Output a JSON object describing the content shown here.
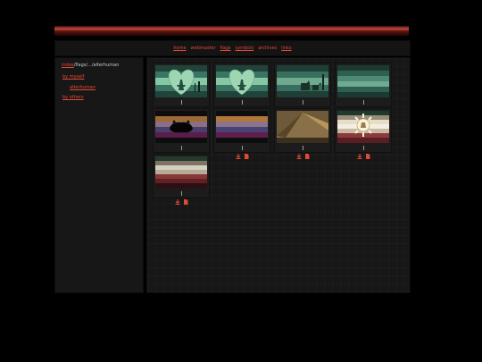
{
  "nav": {
    "items": [
      {
        "label": "home",
        "underline": true
      },
      {
        "label": "webmaster",
        "underline": false
      },
      {
        "label": "flags",
        "underline": true
      },
      {
        "label": "symbols",
        "underline": true
      },
      {
        "label": "archives",
        "underline": false
      },
      {
        "label": "links",
        "underline": true
      }
    ]
  },
  "sidebar": {
    "breadcrumb": {
      "root": "index",
      "sep1": "/",
      "section": "flags",
      "sep2": "/.../",
      "current": "alterhuman"
    },
    "links": [
      {
        "label": "by myself"
      },
      {
        "label": "alterhuman"
      },
      {
        "label": "by others"
      }
    ]
  },
  "gallery": {
    "cards": [
      {
        "thumb": "flag-green-heart-icon"
      },
      {
        "thumb": "flag-green-heart-icon"
      },
      {
        "thumb": "flag-green-stripes-animals-icon"
      },
      {
        "thumb": "flag-green-stripes-icon"
      },
      {
        "thumb": "flag-dusk-silhouette-icon"
      },
      {
        "thumb": "flag-dusk-stripes-icon"
      },
      {
        "thumb": "flag-pyramid-icon"
      },
      {
        "thumb": "flag-sun-stripes-icon"
      },
      {
        "thumb": "flag-grey-red-stripes-icon"
      }
    ]
  },
  "colors": {
    "accent": "#e04a34",
    "background": "#000000",
    "panel": "#171717"
  }
}
